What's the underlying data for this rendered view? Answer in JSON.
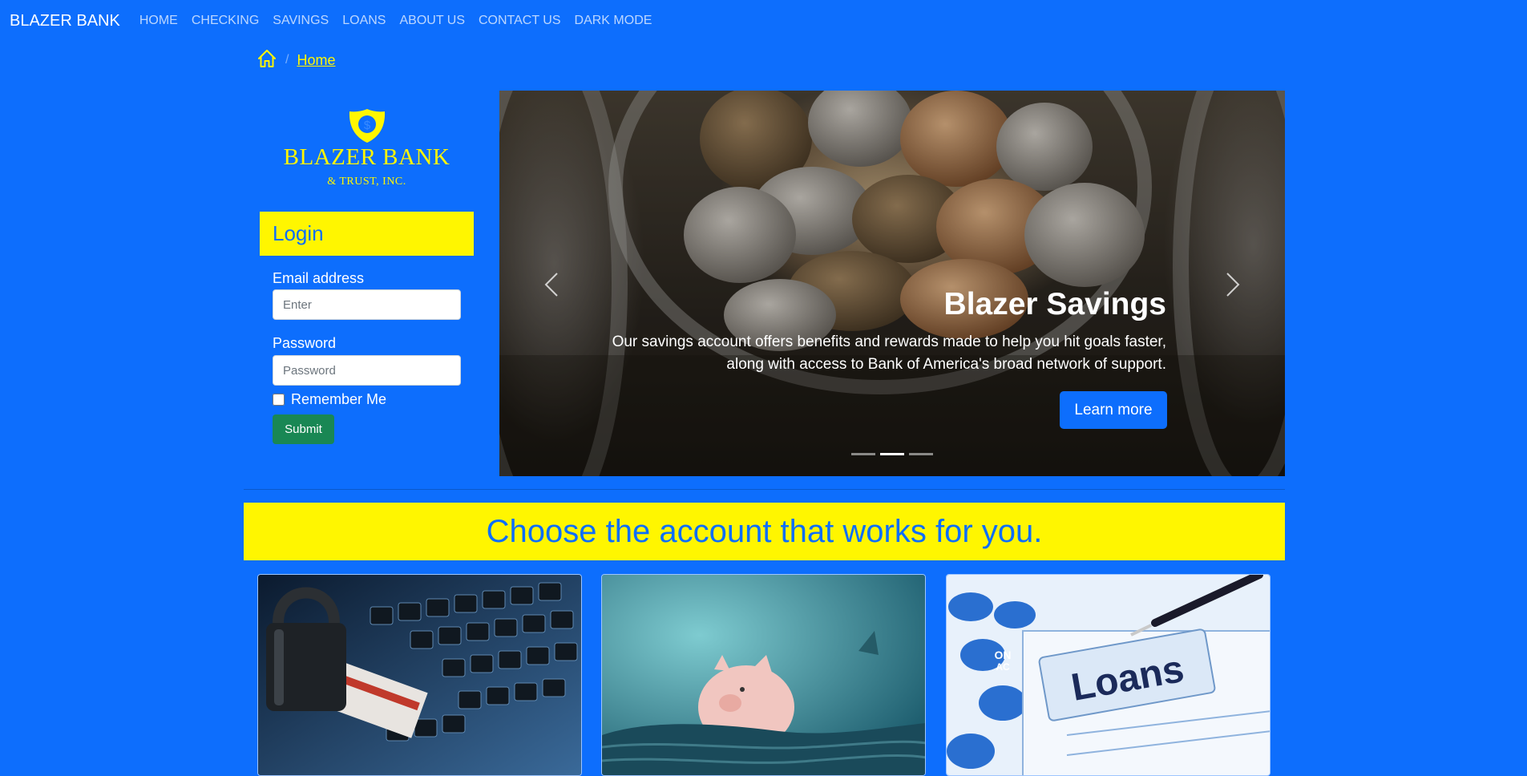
{
  "navbar": {
    "brand": "BLAZER BANK",
    "links": [
      "HOME",
      "CHECKING",
      "SAVINGS",
      "LOANS",
      "ABOUT US",
      "CONTACT US",
      "DARK MODE"
    ]
  },
  "breadcrumb": {
    "icon": "house-icon",
    "items": [
      "Home"
    ]
  },
  "logo": {
    "symbol": "$",
    "title": "BLAZER BANK",
    "subtitle": "& TRUST, INC."
  },
  "login": {
    "heading": "Login",
    "email_label": "Email address",
    "email_placeholder": "Enter",
    "password_label": "Password",
    "password_placeholder": "Password",
    "remember_label": "Remember Me",
    "submit_label": "Submit"
  },
  "carousel": {
    "title": "Blazer Savings",
    "text": "Our savings account offers benefits and rewards made to help you hit goals faster, along with access to Bank of America's broad network of support.",
    "button_label": "Learn more",
    "slide_count": 3,
    "active_slide": 2
  },
  "headline": "Choose the account that works for you.",
  "cards": [
    {
      "image": "padlock-on-keyboard-image"
    },
    {
      "image": "piggy-bank-image"
    },
    {
      "image": "loans-folder-image",
      "image_text": "Loans"
    }
  ],
  "colors": {
    "background": "#0d6efd",
    "accent_yellow": "#fff600",
    "submit_green": "#198754"
  }
}
